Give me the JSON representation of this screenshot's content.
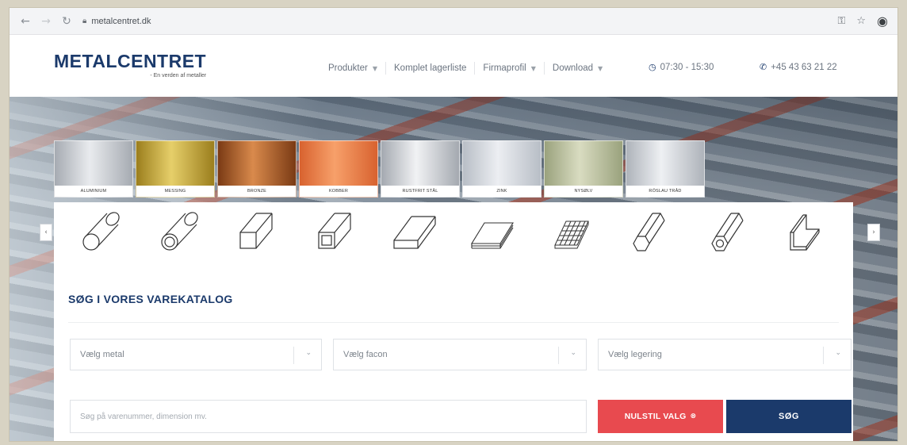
{
  "browser": {
    "url": "metalcentret.dk",
    "icons": [
      "back-arrow-icon",
      "forward-arrow-icon",
      "reload-icon",
      "lock-icon",
      "key-icon",
      "star-icon",
      "profile-icon"
    ]
  },
  "header": {
    "logo_main": "METALCENTRET",
    "logo_sub": "- En verden af metaller",
    "nav": [
      {
        "label": "Produkter",
        "has_caret": true
      },
      {
        "label": "Komplet lagerliste",
        "has_caret": false
      },
      {
        "label": "Firmaprofil",
        "has_caret": true
      },
      {
        "label": "Download",
        "has_caret": true
      }
    ],
    "hours": "07:30 - 15:30",
    "phone": "+45 43 63 21 22",
    "brand_color": "#1b3a6b"
  },
  "metals": [
    {
      "label": "ALUMINIUM",
      "color_a": "#e9ebee",
      "color_b": "#a6abb2"
    },
    {
      "label": "MESSING",
      "color_a": "#e6cf6a",
      "color_b": "#9b7e1d"
    },
    {
      "label": "BRONZE",
      "color_a": "#d98a4c",
      "color_b": "#7a3a14"
    },
    {
      "label": "KOBBER",
      "color_a": "#f7a06a",
      "color_b": "#d8622f"
    },
    {
      "label": "RUSTFRIT STÅL",
      "color_a": "#f1f2f4",
      "color_b": "#a4a9b0"
    },
    {
      "label": "ZINK",
      "color_a": "#eceef2",
      "color_b": "#b8bec6"
    },
    {
      "label": "NYSØLV",
      "color_a": "#d9dcc1",
      "color_b": "#9aa27d"
    },
    {
      "label": "RÖSLAU TRÅD",
      "color_a": "#eef0f3",
      "color_b": "#aeb3ba"
    }
  ],
  "shapes": [
    "round-bar-icon",
    "tube-icon",
    "square-bar-icon",
    "square-tube-icon",
    "flat-bar-icon",
    "sheet-icon",
    "mesh-icon",
    "hex-bar-icon",
    "hex-tube-icon",
    "angle-icon"
  ],
  "search": {
    "title": "SØG I VORES VAREKATALOG",
    "select_metal": "Vælg metal",
    "select_facon": "Vælg facon",
    "select_legering": "Vælg legering",
    "input_placeholder": "Søg på varenummer, dimension mv.",
    "reset_label": "NULSTIL VALG",
    "search_label": "SØG",
    "reset_color": "#e84a4f"
  }
}
